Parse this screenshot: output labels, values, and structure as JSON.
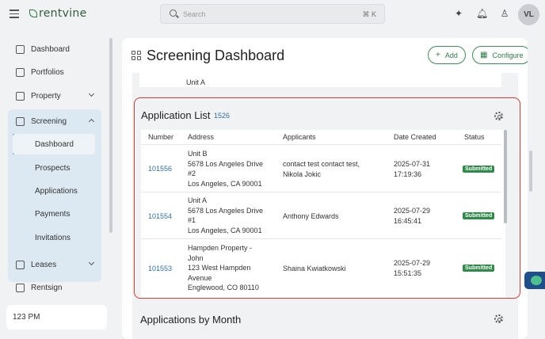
{
  "brand": "rentvine",
  "search": {
    "placeholder": "Search",
    "shortcut": "⌘ K"
  },
  "user": {
    "initials": "VL"
  },
  "sidebar": {
    "items": [
      {
        "label": "Dashboard"
      },
      {
        "label": "Portfolios"
      },
      {
        "label": "Property"
      },
      {
        "label": "Screening"
      },
      {
        "label": "Leases"
      },
      {
        "label": "Rentsign"
      }
    ],
    "screening_sub": [
      {
        "label": "Dashboard"
      },
      {
        "label": "Prospects"
      },
      {
        "label": "Applications"
      },
      {
        "label": "Payments"
      },
      {
        "label": "Invitations"
      }
    ],
    "footer_time": "123 PM"
  },
  "page": {
    "title": "Screening Dashboard",
    "add_label": "Add",
    "configure_label": "Configure",
    "prev_unit": "Unit A"
  },
  "application_list": {
    "title": "Application List",
    "count": "1526",
    "columns": [
      "Number",
      "Address",
      "Applicants",
      "Date Created",
      "Status"
    ],
    "rows": [
      {
        "number": "101556",
        "address": [
          "Unit B",
          "5678 Los Angeles Drive",
          "#2",
          "Los Angeles, CA 90001"
        ],
        "applicants": [
          "contact test contact test,",
          "Nikola Jokic"
        ],
        "date": [
          "2025-07-31",
          "17:19:36"
        ],
        "status": "Submitted"
      },
      {
        "number": "101554",
        "address": [
          "Unit A",
          "5678 Los Angeles Drive",
          "#1",
          "Los Angeles, CA 90001"
        ],
        "applicants": [
          "Anthony Edwards"
        ],
        "date": [
          "2025-07-29",
          "16:45:41"
        ],
        "status": "Submitted"
      },
      {
        "number": "101553",
        "address": [
          "Hampden Property -",
          "John",
          "123 West Hampden",
          "Avenue",
          "Englewood, CO 80110"
        ],
        "applicants": [
          "Shaina Kwiatkowski"
        ],
        "date": [
          "2025-07-29",
          "15:51:35"
        ],
        "status": "Submitted"
      }
    ]
  },
  "by_month": {
    "title": "Applications by Month"
  },
  "colors": {
    "accent": "#2f7a45",
    "link": "#2f6fa5",
    "highlight": "#d93a2f",
    "badge": "#2f8a4a"
  }
}
